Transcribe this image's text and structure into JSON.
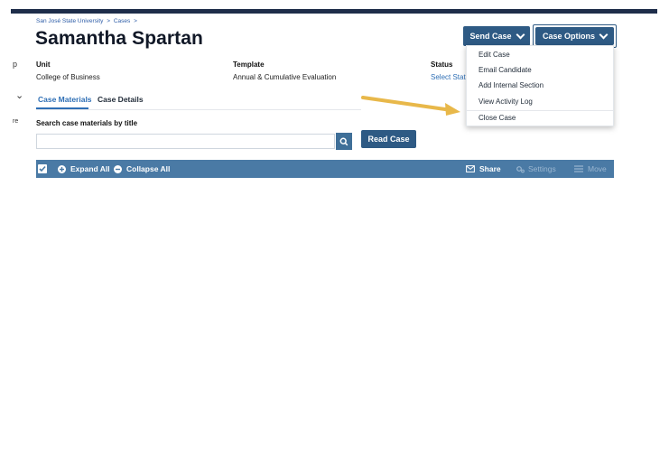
{
  "breadcrumb": {
    "org": "San José State University",
    "sep1": ">",
    "cases": "Cases",
    "sep2": ">"
  },
  "page_title": "Samantha Spartan",
  "side_fragments": {
    "a": "p",
    "b": "⌄",
    "c": "re"
  },
  "info": {
    "unit_label": "Unit",
    "unit_value": "College of Business",
    "template_label": "Template",
    "template_value": "Annual & Cumulative Evaluation",
    "status_label": "Status",
    "status_value": "Select Stat"
  },
  "tabs": [
    {
      "label": "Case Materials",
      "active": true
    },
    {
      "label": "Case Details",
      "active": false
    }
  ],
  "search": {
    "label": "Search case materials by title",
    "placeholder": "",
    "value": ""
  },
  "buttons": {
    "read_case": "Read Case",
    "send_case": "Send Case",
    "case_options": "Case Options"
  },
  "menu": {
    "items": [
      "Edit Case",
      "Email Candidate",
      "Add Internal Section",
      "View Activity Log",
      "Close Case"
    ]
  },
  "toolbar": {
    "expand_all": "Expand All",
    "collapse_all": "Collapse All",
    "share": "Share",
    "settings": "Settings",
    "move": "Move"
  },
  "colors": {
    "accent": "#2e5a84",
    "bar": "#4a7aa5",
    "link": "#2f6fb5",
    "arrow": "#e8b84a",
    "topbar": "#1e2d4a"
  },
  "icons": [
    "search-icon",
    "chevron-down-icon",
    "checkbox-checked-icon",
    "plus-circle-icon",
    "minus-circle-icon",
    "envelope-icon",
    "gear-icon",
    "move-icon",
    "arrow-annotation"
  ]
}
